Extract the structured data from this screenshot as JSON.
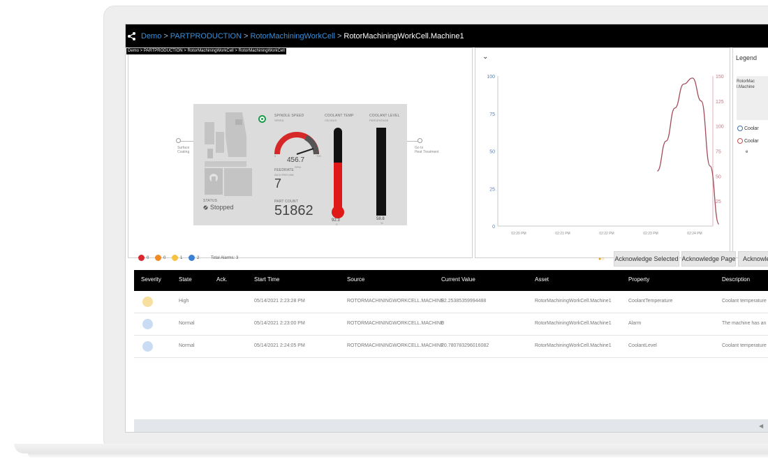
{
  "header": {
    "breadcrumbs": [
      "Demo",
      "PARTPRODUCTION",
      "RotorMachiningWorkCell"
    ],
    "separator": ">",
    "current": "RotorMachiningWorkCell.Machine1",
    "subpath": "Demo > PARTPRODUCTION > RotorMachiningWorkCell > RotorMachiningWorkCell"
  },
  "machine": {
    "left_node_label": [
      "Surface",
      "Coating"
    ],
    "right_node_label": [
      "Go to",
      "Heat Treatment"
    ],
    "spindle_label": "SPINDLE SPEED",
    "spindle_sub": "SPEED",
    "spindle_value": "456.7",
    "spindle_unit": "RPM",
    "gauge_min": "0",
    "gauge_max": "700",
    "feedrate_label": "FEEDRATE",
    "feedrate_sub": "INCH PER MIN",
    "feedrate_value": "7",
    "coolant_temp_label": "COOLANT TEMP",
    "coolant_temp_sub": "CELSIUS",
    "coolant_temp_value": "92.3",
    "coolant_temp_unit": "C",
    "coolant_temp_fill": 0.58,
    "coolant_level_label": "COOLANT LEVEL",
    "coolant_level_sub": "PERCENTAGE",
    "coolant_level_value": "58.8",
    "coolant_level_unit": "%",
    "status_label": "STATUS",
    "status_value": "Stopped",
    "part_count_label": "PART COUNT",
    "part_count_value": "51862"
  },
  "chart_data": {
    "type": "line",
    "y_left_ticks": [
      "100",
      "75",
      "50",
      "25",
      "0"
    ],
    "y_right_ticks": [
      "150",
      "125",
      "100",
      "75",
      "50",
      "25"
    ],
    "x_ticks": [
      "02:20 PM",
      "02:21 PM",
      "02:22 PM",
      "02:23 PM",
      "02:24 PM"
    ],
    "ylim_left": [
      0,
      100
    ],
    "ylim_right": [
      0,
      150
    ],
    "series": [
      {
        "color": "#a04a5a",
        "axis": "right",
        "x": [
          4.15,
          4.35,
          4.55,
          4.75,
          4.95,
          5.15,
          5.35,
          5.55
        ],
        "y": [
          55,
          85,
          118,
          142,
          148,
          125,
          60,
          2
        ]
      }
    ]
  },
  "legend": {
    "title": "Legend",
    "group": [
      "RotorMac",
      "l.Machine"
    ],
    "items": [
      "Coolar",
      "Coolar"
    ],
    "trailing": "e"
  },
  "alarms": {
    "counters": [
      {
        "count": "0",
        "color": "#d9262f"
      },
      {
        "count": "0",
        "color": "#f08a24"
      },
      {
        "count": "1",
        "color": "#f5c242"
      },
      {
        "count": "2",
        "color": "#3b7fd4"
      }
    ],
    "total_label": "Total Alarms: 3",
    "buttons": [
      "Acknowledge Selected",
      "Acknowledge Page",
      "Acknowle"
    ]
  },
  "table": {
    "columns": [
      "Severity",
      "State",
      "Ack.",
      "Start Time",
      "Source",
      "Current Value",
      "Asset",
      "Property",
      "Description"
    ],
    "rows": [
      {
        "severity_color": "#f7dfa0",
        "state": "High",
        "ack": "",
        "start": "05/14/2021 2:23:28 PM",
        "source": "ROTORMACHININGWORKCELL.MACHINE",
        "value": "92.25385359994488",
        "asset": "RotorMachiningWorkCell.Machine1",
        "property": "CoolantTemperature",
        "description": "Coolant temperature"
      },
      {
        "severity_color": "#c9dcf3",
        "state": "Normal",
        "ack": "",
        "start": "05/14/2021 2:23:00 PM",
        "source": "ROTORMACHININGWORKCELL.MACHINE",
        "value": "0",
        "asset": "RotorMachiningWorkCell.Machine1",
        "property": "Alarm",
        "description": "The machine has an"
      },
      {
        "severity_color": "#c9dcf3",
        "state": "Normal",
        "ack": "",
        "start": "05/14/2021 2:24:05 PM",
        "source": "ROTORMACHININGWORKCELL.MACHINE",
        "value": "20.780783296016082",
        "asset": "RotorMachiningWorkCell.Machine1",
        "property": "CoolantLevel",
        "description": "Coolant temperature"
      }
    ]
  }
}
